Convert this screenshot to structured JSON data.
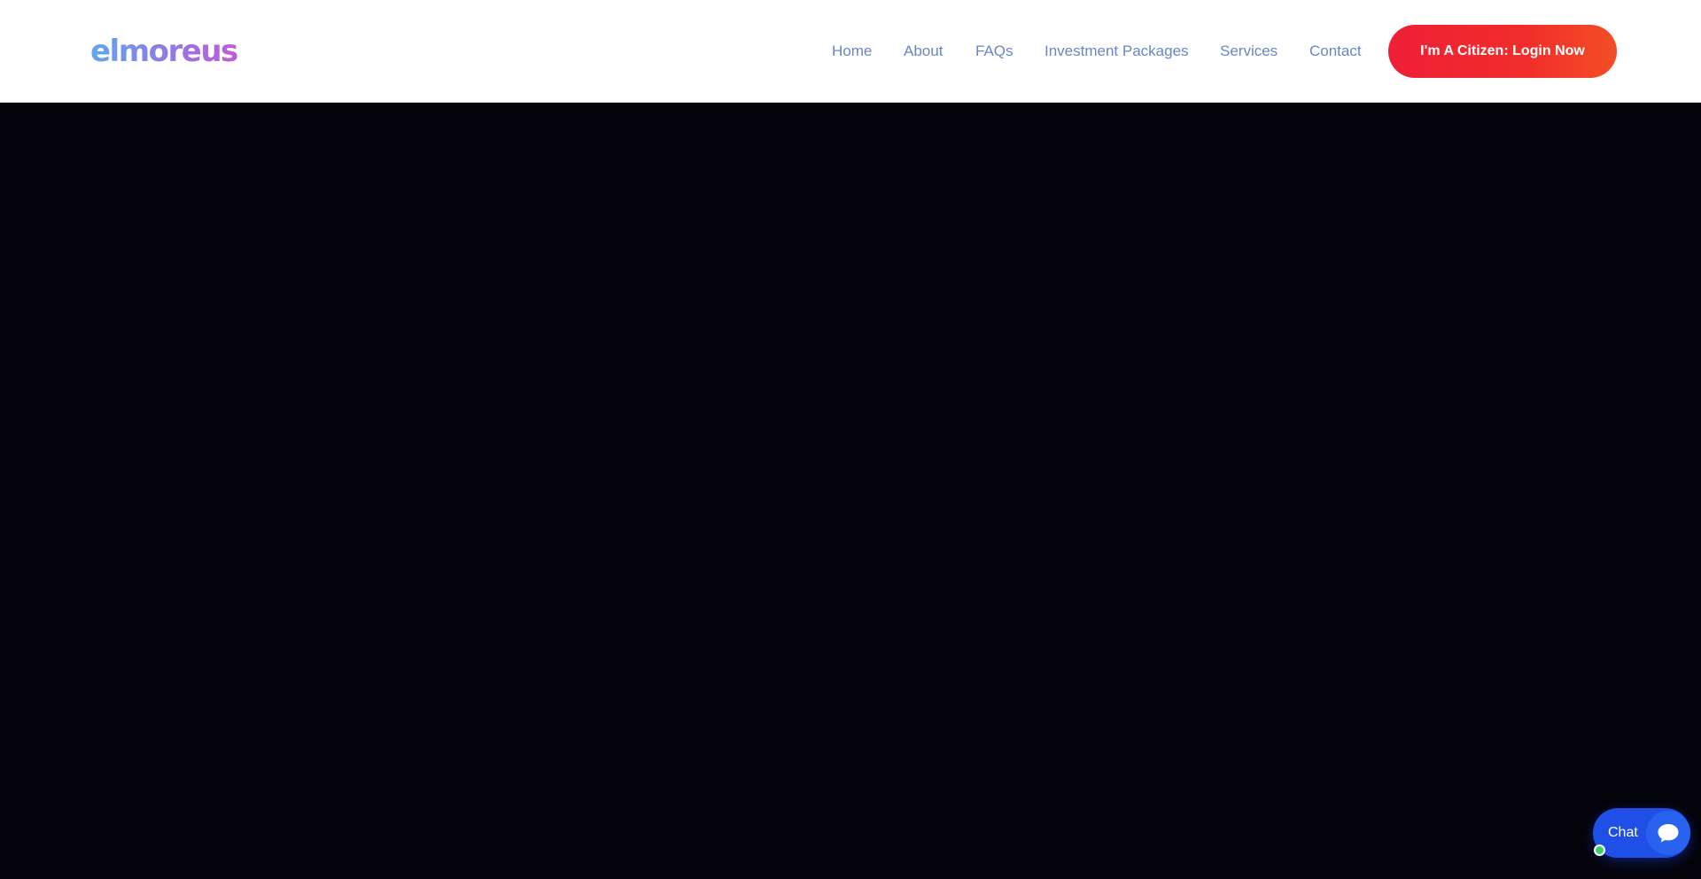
{
  "header": {
    "logo_text": "elmoreus",
    "nav": [
      {
        "label": "Home"
      },
      {
        "label": "About"
      },
      {
        "label": "FAQs"
      },
      {
        "label": "Investment Packages"
      },
      {
        "label": "Services"
      },
      {
        "label": "Contact"
      }
    ],
    "cta_label": "I'm A Citizen: Login Now"
  },
  "chat": {
    "label": "Chat",
    "icon": "chat-bubble-icon",
    "status": "online"
  },
  "colors": {
    "nav_text": "#6886c4",
    "cta_start": "#ee1f36",
    "cta_end": "#f24f23",
    "hero_bg": "#05040b",
    "chat_bg": "#1f4fe6",
    "status_online": "#39d26a"
  }
}
